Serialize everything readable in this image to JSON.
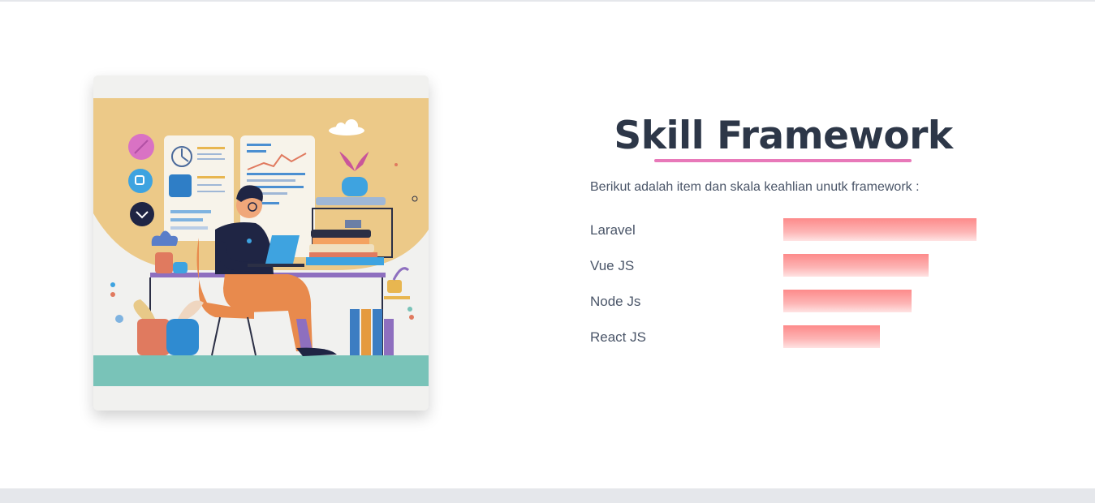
{
  "section": {
    "title": "Skill Framework",
    "intro": "Berikut adalah item dan skala keahlian unutk framework :"
  },
  "skills": [
    {
      "name": "Laravel",
      "level": 1.0
    },
    {
      "name": "Vue JS",
      "level": 0.75
    },
    {
      "name": "Node Js",
      "level": 0.665
    },
    {
      "name": "React JS",
      "level": 0.5
    }
  ],
  "colors": {
    "title": "#2d3748",
    "underline": "#e879b9",
    "bar_top": "#fd8a8a",
    "bar_bottom": "#ffe3e3",
    "footer_bar": "#e5e7eb"
  }
}
